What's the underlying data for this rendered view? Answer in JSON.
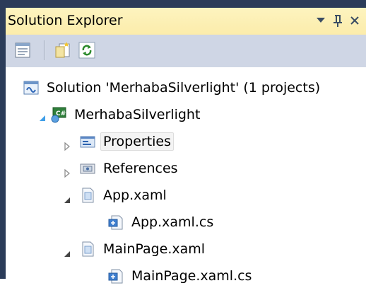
{
  "panel": {
    "title": "Solution Explorer",
    "menu_glyph": "▼",
    "pin_glyph": "ꟷ",
    "close_glyph": "×"
  },
  "toolbar": {
    "buttons": [
      {
        "icon": "properties-window-icon"
      },
      {
        "icon": "show-all-files-icon"
      },
      {
        "icon": "refresh-icon"
      }
    ]
  },
  "tree": {
    "solution": {
      "label": "Solution 'MerhabaSilverlight' (1 projects)",
      "icon": "solution-icon"
    },
    "project": {
      "label": "MerhabaSilverlight",
      "icon": "csharp-project-icon",
      "expanded": true
    },
    "items": [
      {
        "label": "Properties",
        "icon": "properties-folder-icon",
        "expanded": false,
        "selected": true
      },
      {
        "label": "References",
        "icon": "references-folder-icon",
        "expanded": false
      },
      {
        "label": "App.xaml",
        "icon": "xaml-file-icon",
        "expanded": true
      },
      {
        "label": "App.xaml.cs",
        "icon": "cs-file-icon"
      },
      {
        "label": "MainPage.xaml",
        "icon": "xaml-file-icon",
        "expanded": true
      },
      {
        "label": "MainPage.xaml.cs",
        "icon": "cs-file-icon"
      }
    ]
  }
}
